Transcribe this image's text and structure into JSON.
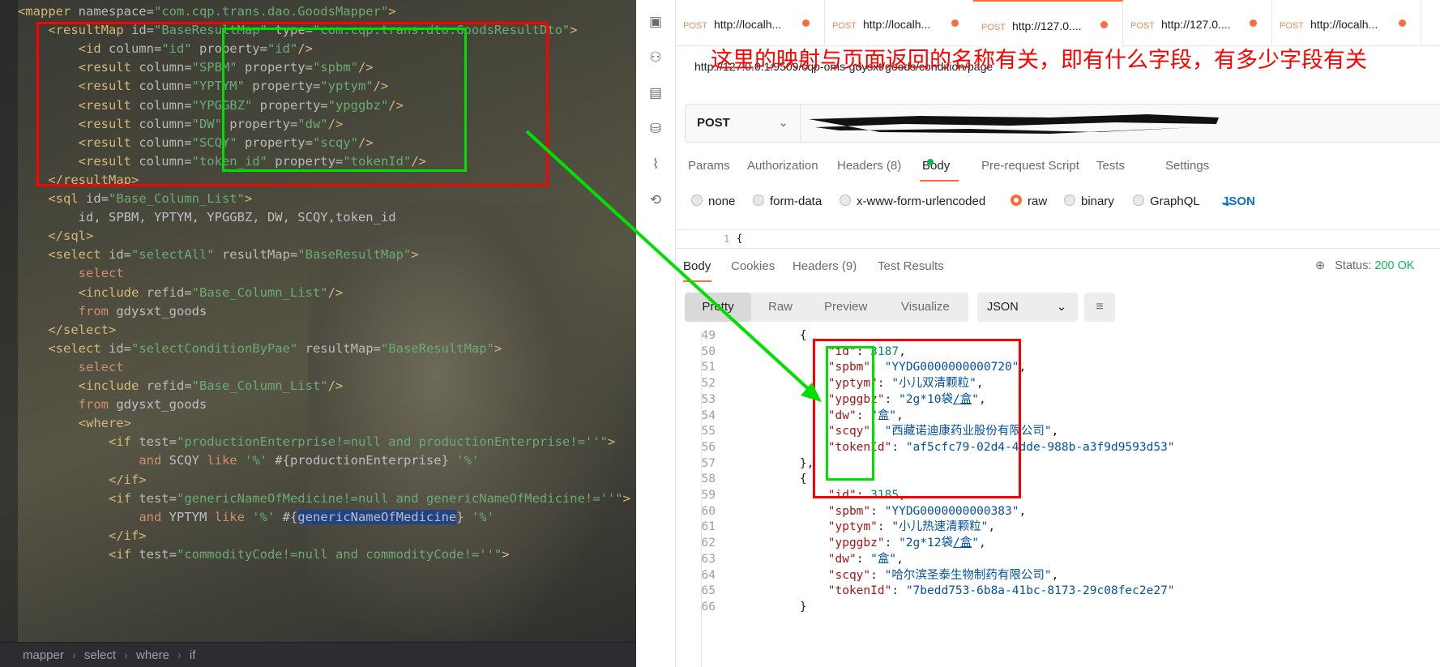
{
  "editor": {
    "lines": [
      [
        {
          "c": "tag",
          "t": "<mapper "
        },
        {
          "c": "attr",
          "t": "namespace="
        },
        {
          "c": "val",
          "t": "\"com.cqp.trans.dao.GoodsMapper\""
        },
        {
          "c": "tag",
          "t": ">"
        }
      ],
      [
        {
          "c": "txt",
          "t": "    "
        },
        {
          "c": "tag",
          "t": "<resultMap "
        },
        {
          "c": "attr",
          "t": "id="
        },
        {
          "c": "val",
          "t": "\"BaseResultMap\""
        },
        {
          "c": "attr",
          "t": " type="
        },
        {
          "c": "val",
          "t": "\"com.cqp.trans.dto.GoodsResultDto\""
        },
        {
          "c": "tag",
          "t": ">"
        }
      ],
      [
        {
          "c": "txt",
          "t": "        "
        },
        {
          "c": "tag",
          "t": "<id "
        },
        {
          "c": "attr",
          "t": "column="
        },
        {
          "c": "val",
          "t": "\"id\""
        },
        {
          "c": "attr",
          "t": " property="
        },
        {
          "c": "val",
          "t": "\"id\""
        },
        {
          "c": "tag",
          "t": "/>"
        }
      ],
      [
        {
          "c": "txt",
          "t": "        "
        },
        {
          "c": "tag",
          "t": "<result "
        },
        {
          "c": "attr",
          "t": "column="
        },
        {
          "c": "val",
          "t": "\"SPBM\""
        },
        {
          "c": "attr",
          "t": " property="
        },
        {
          "c": "val",
          "t": "\"spbm\""
        },
        {
          "c": "tag",
          "t": "/>"
        }
      ],
      [
        {
          "c": "txt",
          "t": "        "
        },
        {
          "c": "tag",
          "t": "<result "
        },
        {
          "c": "attr",
          "t": "column="
        },
        {
          "c": "val",
          "t": "\"YPTYM\""
        },
        {
          "c": "attr",
          "t": " property="
        },
        {
          "c": "val",
          "t": "\"yptym\""
        },
        {
          "c": "tag",
          "t": "/>"
        }
      ],
      [
        {
          "c": "txt",
          "t": "        "
        },
        {
          "c": "tag",
          "t": "<result "
        },
        {
          "c": "attr",
          "t": "column="
        },
        {
          "c": "val",
          "t": "\"YPGGBZ\""
        },
        {
          "c": "attr",
          "t": " property="
        },
        {
          "c": "val",
          "t": "\"ypggbz\""
        },
        {
          "c": "tag",
          "t": "/>"
        }
      ],
      [
        {
          "c": "txt",
          "t": "        "
        },
        {
          "c": "tag",
          "t": "<result "
        },
        {
          "c": "attr",
          "t": "column="
        },
        {
          "c": "val",
          "t": "\"DW\""
        },
        {
          "c": "attr",
          "t": " property="
        },
        {
          "c": "val",
          "t": "\"dw\""
        },
        {
          "c": "tag",
          "t": "/>"
        }
      ],
      [
        {
          "c": "txt",
          "t": "        "
        },
        {
          "c": "tag",
          "t": "<result "
        },
        {
          "c": "attr",
          "t": "column="
        },
        {
          "c": "val",
          "t": "\"SCQY\""
        },
        {
          "c": "attr",
          "t": " property="
        },
        {
          "c": "val",
          "t": "\"scqy\""
        },
        {
          "c": "tag",
          "t": "/>"
        }
      ],
      [
        {
          "c": "txt",
          "t": "        "
        },
        {
          "c": "tag",
          "t": "<result "
        },
        {
          "c": "attr",
          "t": "column="
        },
        {
          "c": "val",
          "t": "\"token_id\""
        },
        {
          "c": "attr",
          "t": " property="
        },
        {
          "c": "val",
          "t": "\"tokenId\""
        },
        {
          "c": "tag",
          "t": "/>"
        }
      ],
      [
        {
          "c": "txt",
          "t": "    "
        },
        {
          "c": "tag",
          "t": "</resultMap>"
        }
      ],
      [
        {
          "c": "txt",
          "t": "    "
        },
        {
          "c": "tag",
          "t": "<sql "
        },
        {
          "c": "attr",
          "t": "id="
        },
        {
          "c": "val",
          "t": "\"Base_Column_List\""
        },
        {
          "c": "tag",
          "t": ">"
        }
      ],
      [
        {
          "c": "txt",
          "t": "        id, SPBM, YPTYM, YPGGBZ, DW, SCQY,token_id"
        }
      ],
      [
        {
          "c": "txt",
          "t": "    "
        },
        {
          "c": "tag",
          "t": "</sql>"
        }
      ],
      [
        {
          "c": "txt",
          "t": "    "
        },
        {
          "c": "tag",
          "t": "<select "
        },
        {
          "c": "attr",
          "t": "id="
        },
        {
          "c": "val",
          "t": "\"selectAll\""
        },
        {
          "c": "attr",
          "t": " resultMap="
        },
        {
          "c": "val",
          "t": "\"BaseResultMap\""
        },
        {
          "c": "tag",
          "t": ">"
        }
      ],
      [
        {
          "c": "txt",
          "t": "        "
        },
        {
          "c": "kw",
          "t": "select"
        }
      ],
      [
        {
          "c": "txt",
          "t": "        "
        },
        {
          "c": "tag",
          "t": "<include "
        },
        {
          "c": "attr",
          "t": "refid="
        },
        {
          "c": "val",
          "t": "\"Base_Column_List\""
        },
        {
          "c": "tag",
          "t": "/>"
        }
      ],
      [
        {
          "c": "txt",
          "t": "        "
        },
        {
          "c": "kw",
          "t": "from"
        },
        {
          "c": "txt",
          "t": " gdysxt_goods"
        }
      ],
      [
        {
          "c": "txt",
          "t": "    "
        },
        {
          "c": "tag",
          "t": "</select>"
        }
      ],
      [
        {
          "c": "txt",
          "t": "    "
        },
        {
          "c": "tag",
          "t": "<select "
        },
        {
          "c": "attr",
          "t": "id="
        },
        {
          "c": "val",
          "t": "\"selectConditionByPae\""
        },
        {
          "c": "attr",
          "t": " resultMap="
        },
        {
          "c": "val",
          "t": "\"BaseResultMap\""
        },
        {
          "c": "tag",
          "t": ">"
        }
      ],
      [
        {
          "c": "txt",
          "t": "        "
        },
        {
          "c": "kw",
          "t": "select"
        }
      ],
      [
        {
          "c": "txt",
          "t": "        "
        },
        {
          "c": "tag",
          "t": "<include "
        },
        {
          "c": "attr",
          "t": "refid="
        },
        {
          "c": "val",
          "t": "\"Base_Column_List\""
        },
        {
          "c": "tag",
          "t": "/>"
        }
      ],
      [
        {
          "c": "txt",
          "t": "        "
        },
        {
          "c": "kw",
          "t": "from"
        },
        {
          "c": "txt",
          "t": " gdysxt_goods"
        }
      ],
      [
        {
          "c": "txt",
          "t": "        "
        },
        {
          "c": "tag",
          "t": "<where>"
        }
      ],
      [
        {
          "c": "txt",
          "t": "            "
        },
        {
          "c": "tag",
          "t": "<if "
        },
        {
          "c": "attr",
          "t": "test="
        },
        {
          "c": "val",
          "t": "\"productionEnterprise!=null and productionEnterprise!=''\""
        },
        {
          "c": "tag",
          "t": ">"
        }
      ],
      [
        {
          "c": "txt",
          "t": "                "
        },
        {
          "c": "kw",
          "t": "and"
        },
        {
          "c": "txt",
          "t": " SCQY "
        },
        {
          "c": "kw",
          "t": "like"
        },
        {
          "c": "val",
          "t": " '%'"
        },
        {
          "c": "txt",
          "t": " #{productionEnterprise} "
        },
        {
          "c": "val",
          "t": "'%'"
        }
      ],
      [
        {
          "c": "txt",
          "t": "            "
        },
        {
          "c": "tag",
          "t": "</if>"
        }
      ],
      [
        {
          "c": "txt",
          "t": "            "
        },
        {
          "c": "tag",
          "t": "<if "
        },
        {
          "c": "attr",
          "t": "test="
        },
        {
          "c": "val",
          "t": "\"genericNameOfMedicine!=null and genericNameOfMedicine!=''\""
        },
        {
          "c": "tag",
          "t": ">"
        }
      ],
      [
        {
          "c": "txt",
          "t": "                "
        },
        {
          "c": "kw",
          "t": "and"
        },
        {
          "c": "txt",
          "t": " YPTYM "
        },
        {
          "c": "kw",
          "t": "like"
        },
        {
          "c": "val",
          "t": " '%'"
        },
        {
          "c": "txt",
          "t": " #{"
        },
        {
          "c": "hl",
          "t": "genericNameOfMedicine"
        },
        {
          "c": "txt",
          "t": "} "
        },
        {
          "c": "val",
          "t": "'%'"
        }
      ],
      [
        {
          "c": "txt",
          "t": "            "
        },
        {
          "c": "tag",
          "t": "</if>"
        }
      ],
      [
        {
          "c": "txt",
          "t": "            "
        },
        {
          "c": "tag",
          "t": "<if "
        },
        {
          "c": "attr",
          "t": "test="
        },
        {
          "c": "val",
          "t": "\"commodityCode!=null and commodityCode!=''\""
        },
        {
          "c": "tag",
          "t": ">"
        }
      ]
    ],
    "breadcrumb": [
      "mapper",
      "select",
      "where",
      "if"
    ]
  },
  "postman": {
    "tabs": [
      {
        "method": "POST",
        "url": "http://localh..."
      },
      {
        "method": "POST",
        "url": "http://localh..."
      },
      {
        "method": "POST",
        "url": "http://127.0...."
      },
      {
        "method": "POST",
        "url": "http://127.0...."
      },
      {
        "method": "POST",
        "url": "http://localh..."
      }
    ],
    "request_url": "http://127.0.0.1:9509/cqp-oms-gdysxt/goods/condition/page",
    "annotation": "这里的映射与页面返回的名称有关，即有什么字段，有多少字段有关",
    "method": "POST",
    "request_tabs": [
      "Params",
      "Authorization",
      "Headers (8)",
      "Body",
      "Pre-request Script",
      "Tests",
      "Settings"
    ],
    "body_types": [
      "none",
      "form-data",
      "x-www-form-urlencoded",
      "raw",
      "binary",
      "GraphQL"
    ],
    "body_format": "JSON",
    "editor_line": "1",
    "editor_first_char": "{",
    "response_tabs": [
      "Body",
      "Cookies",
      "Headers (9)",
      "Test Results"
    ],
    "status_label": "Status:",
    "status_value": "200 OK",
    "view_modes": [
      "Pretty",
      "Raw",
      "Preview",
      "Visualize"
    ],
    "response_format": "JSON",
    "response_lines": [
      {
        "n": "49",
        "t": [
          {
            "c": "p",
            "t": "        {"
          }
        ]
      },
      {
        "n": "50",
        "t": [
          {
            "c": "p",
            "t": "            "
          },
          {
            "c": "k",
            "t": "\"id\""
          },
          {
            "c": "p",
            "t": ": "
          },
          {
            "c": "n",
            "t": "3187"
          },
          {
            "c": "p",
            "t": ","
          }
        ]
      },
      {
        "n": "51",
        "t": [
          {
            "c": "p",
            "t": "            "
          },
          {
            "c": "k",
            "t": "\"spbm\""
          },
          {
            "c": "p",
            "t": ": "
          },
          {
            "c": "s",
            "t": "\"YYDG0000000000720\""
          },
          {
            "c": "p",
            "t": ","
          }
        ]
      },
      {
        "n": "52",
        "t": [
          {
            "c": "p",
            "t": "            "
          },
          {
            "c": "k",
            "t": "\"yptym\""
          },
          {
            "c": "p",
            "t": ": "
          },
          {
            "c": "s",
            "t": "\"小儿双清颗粒\""
          },
          {
            "c": "p",
            "t": ","
          }
        ]
      },
      {
        "n": "53",
        "t": [
          {
            "c": "p",
            "t": "            "
          },
          {
            "c": "k",
            "t": "\"ypggbz\""
          },
          {
            "c": "p",
            "t": ": "
          },
          {
            "c": "s",
            "t": "\"2g*10袋"
          },
          {
            "c": "u",
            "t": "/盒"
          },
          {
            "c": "s",
            "t": "\""
          },
          {
            "c": "p",
            "t": ","
          }
        ]
      },
      {
        "n": "54",
        "t": [
          {
            "c": "p",
            "t": "            "
          },
          {
            "c": "k",
            "t": "\"dw\""
          },
          {
            "c": "p",
            "t": ": "
          },
          {
            "c": "s",
            "t": "\"盒\""
          },
          {
            "c": "p",
            "t": ","
          }
        ]
      },
      {
        "n": "55",
        "t": [
          {
            "c": "p",
            "t": "            "
          },
          {
            "c": "k",
            "t": "\"scqy\""
          },
          {
            "c": "p",
            "t": ": "
          },
          {
            "c": "s",
            "t": "\"西藏诺迪康药业股份有限公司\""
          },
          {
            "c": "p",
            "t": ","
          }
        ]
      },
      {
        "n": "56",
        "t": [
          {
            "c": "p",
            "t": "            "
          },
          {
            "c": "k",
            "t": "\"tokenId\""
          },
          {
            "c": "p",
            "t": ": "
          },
          {
            "c": "s",
            "t": "\"af5cfc79-02d4-4dde-988b-a3f9d9593d53\""
          }
        ]
      },
      {
        "n": "57",
        "t": [
          {
            "c": "p",
            "t": "        },"
          }
        ]
      },
      {
        "n": "58",
        "t": [
          {
            "c": "p",
            "t": "        {"
          }
        ]
      },
      {
        "n": "59",
        "t": [
          {
            "c": "p",
            "t": "            "
          },
          {
            "c": "k",
            "t": "\"id\""
          },
          {
            "c": "p",
            "t": ": "
          },
          {
            "c": "n",
            "t": "3185"
          },
          {
            "c": "p",
            "t": ","
          }
        ]
      },
      {
        "n": "60",
        "t": [
          {
            "c": "p",
            "t": "            "
          },
          {
            "c": "k",
            "t": "\"spbm\""
          },
          {
            "c": "p",
            "t": ": "
          },
          {
            "c": "s",
            "t": "\"YYDG0000000000383\""
          },
          {
            "c": "p",
            "t": ","
          }
        ]
      },
      {
        "n": "61",
        "t": [
          {
            "c": "p",
            "t": "            "
          },
          {
            "c": "k",
            "t": "\"yptym\""
          },
          {
            "c": "p",
            "t": ": "
          },
          {
            "c": "s",
            "t": "\"小儿热速清颗粒\""
          },
          {
            "c": "p",
            "t": ","
          }
        ]
      },
      {
        "n": "62",
        "t": [
          {
            "c": "p",
            "t": "            "
          },
          {
            "c": "k",
            "t": "\"ypggbz\""
          },
          {
            "c": "p",
            "t": ": "
          },
          {
            "c": "s",
            "t": "\"2g*12袋"
          },
          {
            "c": "u",
            "t": "/盒"
          },
          {
            "c": "s",
            "t": "\""
          },
          {
            "c": "p",
            "t": ","
          }
        ]
      },
      {
        "n": "63",
        "t": [
          {
            "c": "p",
            "t": "            "
          },
          {
            "c": "k",
            "t": "\"dw\""
          },
          {
            "c": "p",
            "t": ": "
          },
          {
            "c": "s",
            "t": "\"盒\""
          },
          {
            "c": "p",
            "t": ","
          }
        ]
      },
      {
        "n": "64",
        "t": [
          {
            "c": "p",
            "t": "            "
          },
          {
            "c": "k",
            "t": "\"scqy\""
          },
          {
            "c": "p",
            "t": ": "
          },
          {
            "c": "s",
            "t": "\"哈尔滨圣泰生物制药有限公司\""
          },
          {
            "c": "p",
            "t": ","
          }
        ]
      },
      {
        "n": "65",
        "t": [
          {
            "c": "p",
            "t": "            "
          },
          {
            "c": "k",
            "t": "\"tokenId\""
          },
          {
            "c": "p",
            "t": ": "
          },
          {
            "c": "s",
            "t": "\"7bedd753-6b8a-41bc-8173-29c08fec2e27\""
          }
        ]
      },
      {
        "n": "66",
        "t": [
          {
            "c": "p",
            "t": "        }"
          }
        ]
      }
    ]
  },
  "colors": {
    "annotation_red": "#ff0000",
    "annotation_green": "#00e000",
    "postman_orange": "#ff6c37",
    "status_green": "#0cbb52"
  }
}
